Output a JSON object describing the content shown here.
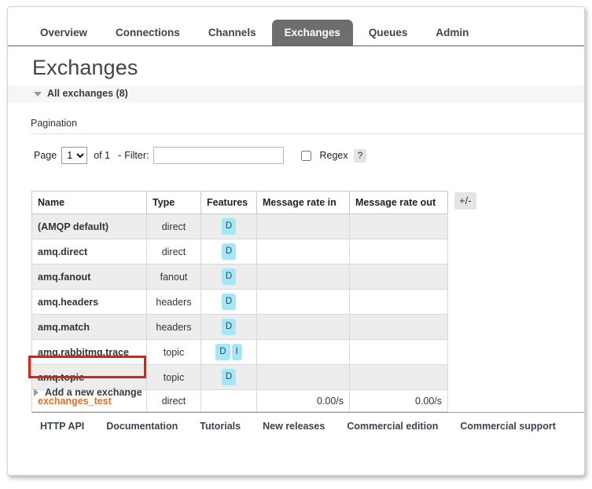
{
  "nav": {
    "tabs": [
      {
        "label": "Overview",
        "active": false
      },
      {
        "label": "Connections",
        "active": false
      },
      {
        "label": "Channels",
        "active": false
      },
      {
        "label": "Exchanges",
        "active": true
      },
      {
        "label": "Queues",
        "active": false
      },
      {
        "label": "Admin",
        "active": false
      }
    ]
  },
  "page": {
    "title": "Exchanges",
    "section_header": "All exchanges (8)",
    "pagination_label": "Pagination",
    "add_new_label": "Add a new exchange"
  },
  "pagination": {
    "page_word": "Page",
    "page_value": "1",
    "page_options": [
      "1"
    ],
    "of_text": "of 1",
    "dash": "-",
    "filter_label": "Filter:",
    "filter_value": "",
    "filter_placeholder": "",
    "regex_label": "Regex",
    "regex_checked": false,
    "help_label": "?"
  },
  "table": {
    "columns": [
      "Name",
      "Type",
      "Features",
      "Message rate in",
      "Message rate out"
    ],
    "expand_button": "+/-",
    "rows": [
      {
        "name": "(AMQP default)",
        "type": "direct",
        "features": [
          "D"
        ],
        "rate_in": "",
        "rate_out": "",
        "link": false
      },
      {
        "name": "amq.direct",
        "type": "direct",
        "features": [
          "D"
        ],
        "rate_in": "",
        "rate_out": "",
        "link": false
      },
      {
        "name": "amq.fanout",
        "type": "fanout",
        "features": [
          "D"
        ],
        "rate_in": "",
        "rate_out": "",
        "link": false
      },
      {
        "name": "amq.headers",
        "type": "headers",
        "features": [
          "D"
        ],
        "rate_in": "",
        "rate_out": "",
        "link": false
      },
      {
        "name": "amq.match",
        "type": "headers",
        "features": [
          "D"
        ],
        "rate_in": "",
        "rate_out": "",
        "link": false
      },
      {
        "name": "amq.rabbitmq.trace",
        "type": "topic",
        "features": [
          "D",
          "I"
        ],
        "rate_in": "",
        "rate_out": "",
        "link": false
      },
      {
        "name": "amq.topic",
        "type": "topic",
        "features": [
          "D"
        ],
        "rate_in": "",
        "rate_out": "",
        "link": false
      },
      {
        "name": "exchanges_test",
        "type": "direct",
        "features": [],
        "rate_in": "0.00/s",
        "rate_out": "0.00/s",
        "link": true
      }
    ]
  },
  "footer": {
    "links": [
      "HTTP API",
      "Documentation",
      "Tutorials",
      "New releases",
      "Commercial edition",
      "Commercial support"
    ]
  },
  "annotation": {
    "highlight_target": "exchanges_test",
    "highlight_color": "#e41f11"
  }
}
